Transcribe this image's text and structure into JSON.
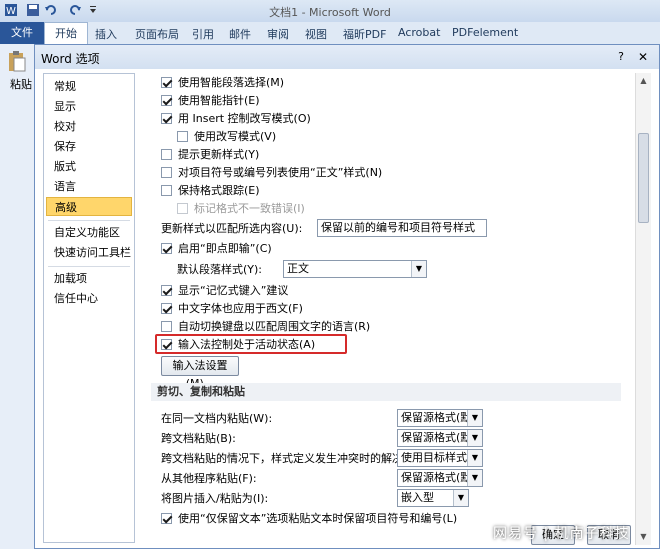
{
  "app": {
    "title": "文档1 - Microsoft Word",
    "file_tab": "文件",
    "tabs": [
      "开始",
      "插入",
      "页面布局",
      "引用",
      "邮件",
      "审阅",
      "视图",
      "福昕PDF",
      "Acrobat",
      "PDFelement"
    ],
    "ribbon_left": {
      "paste_label": "粘贴"
    }
  },
  "dialog": {
    "title": "Word 选项",
    "help": "?",
    "close": "✕",
    "nav": [
      "常规",
      "显示",
      "校对",
      "保存",
      "版式",
      "语言",
      "高级",
      "自定义功能区",
      "快速访问工具栏",
      "加载项",
      "信任中心"
    ],
    "nav_selected": "高级",
    "options": [
      {
        "label": "使用智能段落选择(M)",
        "checked": true
      },
      {
        "label": "使用智能指针(E)",
        "checked": true
      },
      {
        "label": "用 Insert 控制改写模式(O)",
        "checked": true
      },
      {
        "label": "使用改写模式(V)",
        "checked": false
      },
      {
        "label": "提示更新样式(Y)",
        "checked": false
      },
      {
        "label": "对项目符号或编号列表使用“正文”样式(N)",
        "checked": false
      },
      {
        "label": "保持格式跟踪(E)",
        "checked": false
      },
      {
        "label": "标记格式不一致错误(I)",
        "checked": false,
        "disabled": true
      }
    ],
    "update_style_label": "更新样式以匹配所选内容(U):",
    "update_style_value": "保留以前的编号和项目符号样式",
    "click_and_type": {
      "label": "启用“即点即输”(C)",
      "checked": true
    },
    "default_para_label": "默认段落样式(Y):",
    "default_para_value": "正文",
    "options2": [
      {
        "label": "显示“记忆式键入”建议",
        "checked": true
      },
      {
        "label": "中文字体也应用于西文(F)",
        "checked": true
      },
      {
        "label": "自动切换键盘以匹配周围文字的语言(R)",
        "checked": false
      },
      {
        "label": "输入法控制处于活动状态(A)",
        "checked": true
      }
    ],
    "ime_settings_button": "输入法设置(M)...",
    "section_title": "剪切、复制和粘贴",
    "paste_rows": [
      {
        "label": "在同一文档内粘贴(W):",
        "value": "保留源格式(默认)"
      },
      {
        "label": "跨文档粘贴(B):",
        "value": "保留源格式(默认)"
      },
      {
        "label": "跨文档粘贴的情况下，样式定义发生冲突时的解决方法(E):",
        "value": "使用目标样式(默认)"
      },
      {
        "label": "从其他程序粘贴(F):",
        "value": "保留源格式(默认)"
      },
      {
        "label": "将图片插入/粘贴为(I):",
        "value": "嵌入型"
      }
    ],
    "last_option": {
      "label": "使用“仅保留文本”选项粘贴文本时保留项目符号和编号(L)",
      "checked": true
    },
    "ok": "确定",
    "cancel": "取消"
  },
  "watermark": "网易号 | 机南子科技"
}
